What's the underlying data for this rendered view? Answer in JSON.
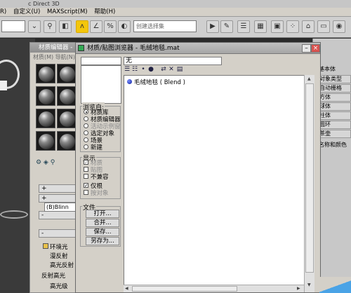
{
  "app": {
    "title": "c Direct 3D",
    "menu": [
      "R)",
      "自定义(U)",
      "MAXScript(M)",
      "帮助(H)"
    ],
    "selection_set_placeholder": "创建选择集",
    "toolbar_dropdown_value": ""
  },
  "right_panel": {
    "label_basic": "基本体",
    "buttons": [
      "对象类型",
      "自动栅格",
      "方体",
      "球体",
      "柱体",
      "圆环",
      "茶壶"
    ],
    "name_color": "名称和颜色"
  },
  "material_editor": {
    "title": "材质编辑器 -",
    "menu": "材质(M)   导航(N)",
    "rollout_plus_1": "+",
    "rollout_plus_2": "+",
    "rollout_minus_1": "-",
    "shader": "(B)Blinn",
    "rollout_minus_2": "-",
    "param_labels": [
      "环境光",
      "漫反射",
      "高光反射",
      "反射高光",
      "高光级"
    ]
  },
  "browser": {
    "title": "材质/贴图浏览器 - 毛绒地毯.mat",
    "name_field": "无",
    "browse_from": {
      "label": "浏览自:",
      "options": [
        {
          "label": "材质库",
          "selected": true,
          "enabled": true
        },
        {
          "label": "材质编辑器",
          "selected": false,
          "enabled": true
        },
        {
          "label": "活动示例窗",
          "selected": false,
          "enabled": false
        },
        {
          "label": "选定对象",
          "selected": false,
          "enabled": true
        },
        {
          "label": "场景",
          "selected": false,
          "enabled": true
        },
        {
          "label": "新建",
          "selected": false,
          "enabled": true
        }
      ]
    },
    "show": {
      "label": "显示",
      "options": [
        {
          "label": "材质",
          "checked": true,
          "enabled": false
        },
        {
          "label": "贴图",
          "checked": false,
          "enabled": false
        },
        {
          "label": "不兼容",
          "checked": false,
          "enabled": true
        },
        {
          "label": "仅根",
          "checked": true,
          "enabled": true
        },
        {
          "label": "按对象",
          "checked": false,
          "enabled": false
        }
      ]
    },
    "file": {
      "label": "文件",
      "buttons": [
        "打开...",
        "合并...",
        "保存...",
        "另存为..."
      ]
    },
    "list_items": [
      "毛绒地毯  ( Blend )"
    ]
  }
}
